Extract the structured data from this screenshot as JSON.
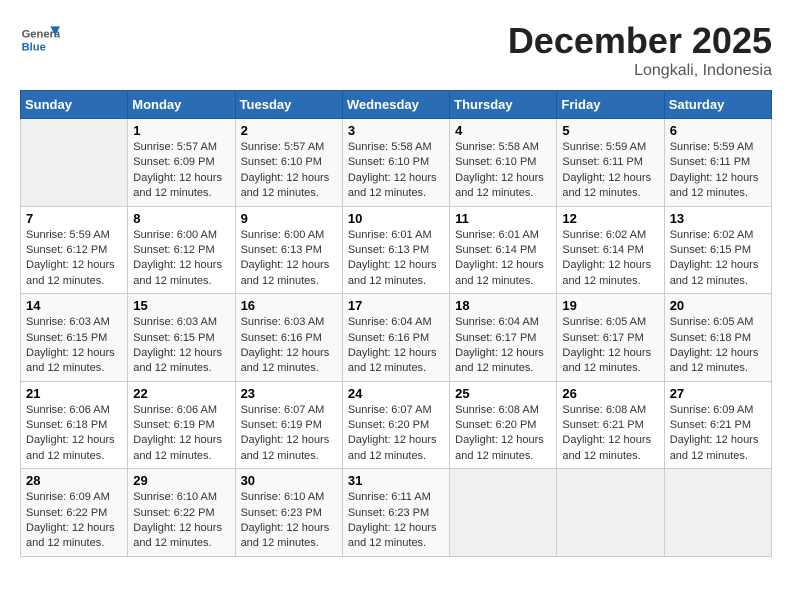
{
  "logo": {
    "general": "General",
    "blue": "Blue"
  },
  "title": "December 2025",
  "location": "Longkali, Indonesia",
  "days_of_week": [
    "Sunday",
    "Monday",
    "Tuesday",
    "Wednesday",
    "Thursday",
    "Friday",
    "Saturday"
  ],
  "weeks": [
    [
      {
        "day": "",
        "info": ""
      },
      {
        "day": "1",
        "info": "Sunrise: 5:57 AM\nSunset: 6:09 PM\nDaylight: 12 hours\nand 12 minutes."
      },
      {
        "day": "2",
        "info": "Sunrise: 5:57 AM\nSunset: 6:10 PM\nDaylight: 12 hours\nand 12 minutes."
      },
      {
        "day": "3",
        "info": "Sunrise: 5:58 AM\nSunset: 6:10 PM\nDaylight: 12 hours\nand 12 minutes."
      },
      {
        "day": "4",
        "info": "Sunrise: 5:58 AM\nSunset: 6:10 PM\nDaylight: 12 hours\nand 12 minutes."
      },
      {
        "day": "5",
        "info": "Sunrise: 5:59 AM\nSunset: 6:11 PM\nDaylight: 12 hours\nand 12 minutes."
      },
      {
        "day": "6",
        "info": "Sunrise: 5:59 AM\nSunset: 6:11 PM\nDaylight: 12 hours\nand 12 minutes."
      }
    ],
    [
      {
        "day": "7",
        "info": "Sunrise: 5:59 AM\nSunset: 6:12 PM\nDaylight: 12 hours\nand 12 minutes."
      },
      {
        "day": "8",
        "info": "Sunrise: 6:00 AM\nSunset: 6:12 PM\nDaylight: 12 hours\nand 12 minutes."
      },
      {
        "day": "9",
        "info": "Sunrise: 6:00 AM\nSunset: 6:13 PM\nDaylight: 12 hours\nand 12 minutes."
      },
      {
        "day": "10",
        "info": "Sunrise: 6:01 AM\nSunset: 6:13 PM\nDaylight: 12 hours\nand 12 minutes."
      },
      {
        "day": "11",
        "info": "Sunrise: 6:01 AM\nSunset: 6:14 PM\nDaylight: 12 hours\nand 12 minutes."
      },
      {
        "day": "12",
        "info": "Sunrise: 6:02 AM\nSunset: 6:14 PM\nDaylight: 12 hours\nand 12 minutes."
      },
      {
        "day": "13",
        "info": "Sunrise: 6:02 AM\nSunset: 6:15 PM\nDaylight: 12 hours\nand 12 minutes."
      }
    ],
    [
      {
        "day": "14",
        "info": "Sunrise: 6:03 AM\nSunset: 6:15 PM\nDaylight: 12 hours\nand 12 minutes."
      },
      {
        "day": "15",
        "info": "Sunrise: 6:03 AM\nSunset: 6:15 PM\nDaylight: 12 hours\nand 12 minutes."
      },
      {
        "day": "16",
        "info": "Sunrise: 6:03 AM\nSunset: 6:16 PM\nDaylight: 12 hours\nand 12 minutes."
      },
      {
        "day": "17",
        "info": "Sunrise: 6:04 AM\nSunset: 6:16 PM\nDaylight: 12 hours\nand 12 minutes."
      },
      {
        "day": "18",
        "info": "Sunrise: 6:04 AM\nSunset: 6:17 PM\nDaylight: 12 hours\nand 12 minutes."
      },
      {
        "day": "19",
        "info": "Sunrise: 6:05 AM\nSunset: 6:17 PM\nDaylight: 12 hours\nand 12 minutes."
      },
      {
        "day": "20",
        "info": "Sunrise: 6:05 AM\nSunset: 6:18 PM\nDaylight: 12 hours\nand 12 minutes."
      }
    ],
    [
      {
        "day": "21",
        "info": "Sunrise: 6:06 AM\nSunset: 6:18 PM\nDaylight: 12 hours\nand 12 minutes."
      },
      {
        "day": "22",
        "info": "Sunrise: 6:06 AM\nSunset: 6:19 PM\nDaylight: 12 hours\nand 12 minutes."
      },
      {
        "day": "23",
        "info": "Sunrise: 6:07 AM\nSunset: 6:19 PM\nDaylight: 12 hours\nand 12 minutes."
      },
      {
        "day": "24",
        "info": "Sunrise: 6:07 AM\nSunset: 6:20 PM\nDaylight: 12 hours\nand 12 minutes."
      },
      {
        "day": "25",
        "info": "Sunrise: 6:08 AM\nSunset: 6:20 PM\nDaylight: 12 hours\nand 12 minutes."
      },
      {
        "day": "26",
        "info": "Sunrise: 6:08 AM\nSunset: 6:21 PM\nDaylight: 12 hours\nand 12 minutes."
      },
      {
        "day": "27",
        "info": "Sunrise: 6:09 AM\nSunset: 6:21 PM\nDaylight: 12 hours\nand 12 minutes."
      }
    ],
    [
      {
        "day": "28",
        "info": "Sunrise: 6:09 AM\nSunset: 6:22 PM\nDaylight: 12 hours\nand 12 minutes."
      },
      {
        "day": "29",
        "info": "Sunrise: 6:10 AM\nSunset: 6:22 PM\nDaylight: 12 hours\nand 12 minutes."
      },
      {
        "day": "30",
        "info": "Sunrise: 6:10 AM\nSunset: 6:23 PM\nDaylight: 12 hours\nand 12 minutes."
      },
      {
        "day": "31",
        "info": "Sunrise: 6:11 AM\nSunset: 6:23 PM\nDaylight: 12 hours\nand 12 minutes."
      },
      {
        "day": "",
        "info": ""
      },
      {
        "day": "",
        "info": ""
      },
      {
        "day": "",
        "info": ""
      }
    ]
  ]
}
